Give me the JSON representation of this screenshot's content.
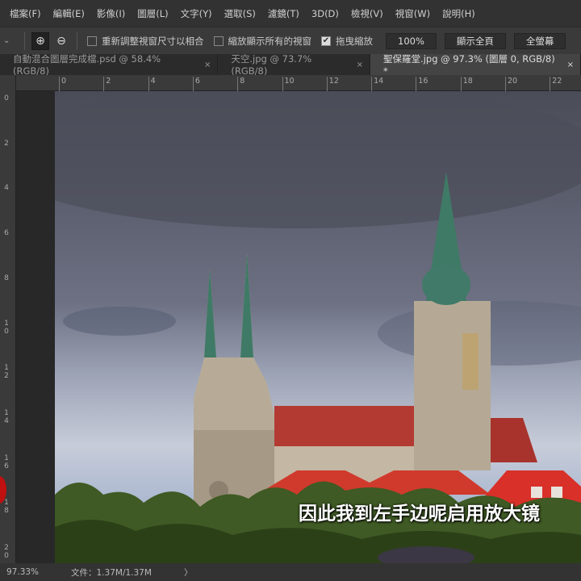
{
  "menu": [
    "檔案(F)",
    "編輯(E)",
    "影像(I)",
    "圖層(L)",
    "文字(Y)",
    "選取(S)",
    "濾鏡(T)",
    "3D(D)",
    "檢視(V)",
    "視窗(W)",
    "說明(H)"
  ],
  "options": {
    "zoom_in_icon": "zoom-in-icon",
    "zoom_out_icon": "zoom-out-icon",
    "resize_windows": {
      "label": "重新調整視窗尺寸以相合",
      "checked": false
    },
    "zoom_all_windows": {
      "label": "縮放顯示所有的視窗",
      "checked": false
    },
    "scrubby_zoom": {
      "label": "拖曳縮放",
      "checked": true
    },
    "btn_100": "100%",
    "btn_fit": "顯示全頁",
    "btn_fill": "全螢幕"
  },
  "tabs": [
    {
      "label": "自動混合圖層完成檔.psd @ 58.4% (RGB/8)",
      "active": false
    },
    {
      "label": "天空.jpg @ 73.7% (RGB/8)",
      "active": false
    },
    {
      "label": "聖保羅堂.jpg @ 97.3% (圖層 0, RGB/8) *",
      "active": true
    }
  ],
  "close_glyph": "×",
  "hruler": [
    "0",
    "2",
    "4",
    "6",
    "8",
    "10",
    "12",
    "14",
    "16",
    "18",
    "20",
    "22"
  ],
  "vruler": [
    "0",
    "2",
    "4",
    "6",
    "8",
    "10",
    "12",
    "14",
    "16",
    "18",
    "20"
  ],
  "subtitle": "因此我到左手边呢启用放大镜",
  "status": {
    "zoom": "97.33%",
    "doc": "文件：1.37M/1.37M",
    "arrow": "〉"
  }
}
